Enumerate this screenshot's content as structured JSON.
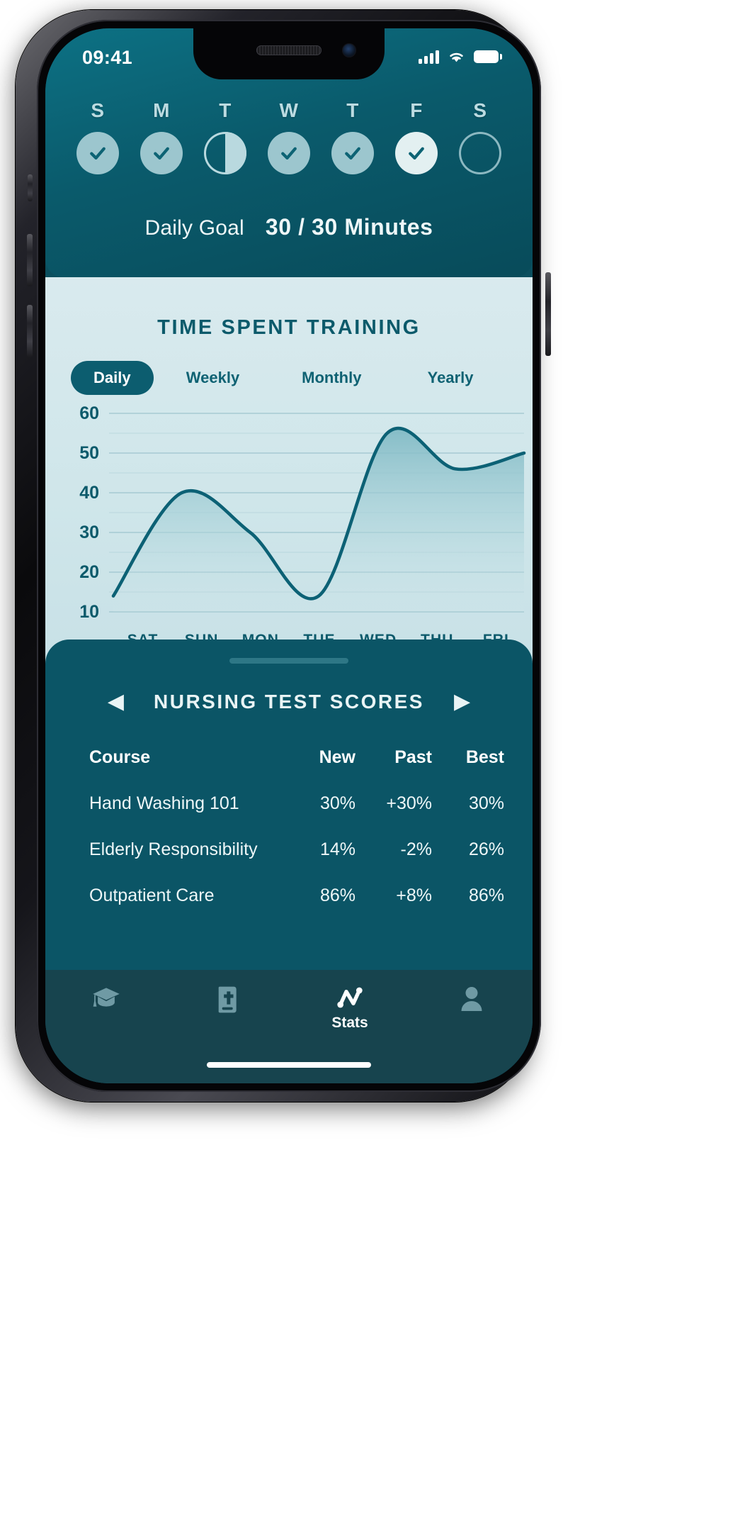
{
  "status": {
    "time": "09:41",
    "icons": [
      "cellular-signal-icon",
      "wifi-icon",
      "battery-icon"
    ]
  },
  "header": {
    "week": [
      {
        "letter": "S",
        "state": "done"
      },
      {
        "letter": "M",
        "state": "done"
      },
      {
        "letter": "T",
        "state": "half"
      },
      {
        "letter": "W",
        "state": "done"
      },
      {
        "letter": "T",
        "state": "done"
      },
      {
        "letter": "F",
        "state": "today"
      },
      {
        "letter": "S",
        "state": "empty"
      }
    ],
    "goal_label": "Daily Goal",
    "goal_value": "30 / 30 Minutes"
  },
  "chart": {
    "tabs": [
      {
        "label": "Daily",
        "active": true
      },
      {
        "label": "Weekly",
        "active": false
      },
      {
        "label": "Monthly",
        "active": false
      },
      {
        "label": "Yearly",
        "active": false
      }
    ]
  },
  "chart_data": {
    "type": "area",
    "title": "TIME SPENT TRAINING",
    "xlabel": "",
    "ylabel": "",
    "categories": [
      "SAT",
      "SUN",
      "MON",
      "TUE",
      "WED",
      "THU",
      "FRI"
    ],
    "values": [
      14,
      40,
      30,
      14,
      55,
      46,
      50
    ],
    "ytick_labels": [
      "60",
      "50",
      "40",
      "30",
      "20",
      "10"
    ],
    "ytick_values": [
      60,
      50,
      40,
      30,
      20,
      10
    ],
    "ylim": [
      10,
      60
    ],
    "gridline_step": 5,
    "grid": true,
    "legend": "none",
    "line_color": "#0c6175",
    "fill_color": "#8fc3cd",
    "smoothing": "spline"
  },
  "scores": {
    "title": "NURSING TEST SCORES",
    "prev_icon": "◀",
    "next_icon": "▶",
    "columns": [
      "Course",
      "New",
      "Past",
      "Best"
    ],
    "rows": [
      {
        "course": "Hand Washing 101",
        "new": "30%",
        "past": "+30%",
        "best": "30%"
      },
      {
        "course": "Elderly Responsibility",
        "new": "14%",
        "past": "-2%",
        "best": "26%"
      },
      {
        "course": "Outpatient Care",
        "new": "86%",
        "past": "+8%",
        "best": "86%"
      }
    ]
  },
  "tabbar": {
    "items": [
      {
        "icon": "graduation-cap-icon",
        "label": "",
        "active": false
      },
      {
        "icon": "medical-book-icon",
        "label": "",
        "active": false
      },
      {
        "icon": "stats-chart-icon",
        "label": "Stats",
        "active": true
      },
      {
        "icon": "person-icon",
        "label": "",
        "active": false
      }
    ]
  },
  "theme": {
    "teal_dark": "#0b5566",
    "teal_header": "#0a5a6b",
    "panel_light": "#cfe6ea",
    "accent": "#0c6175",
    "tabbar_bg": "#17444e"
  }
}
